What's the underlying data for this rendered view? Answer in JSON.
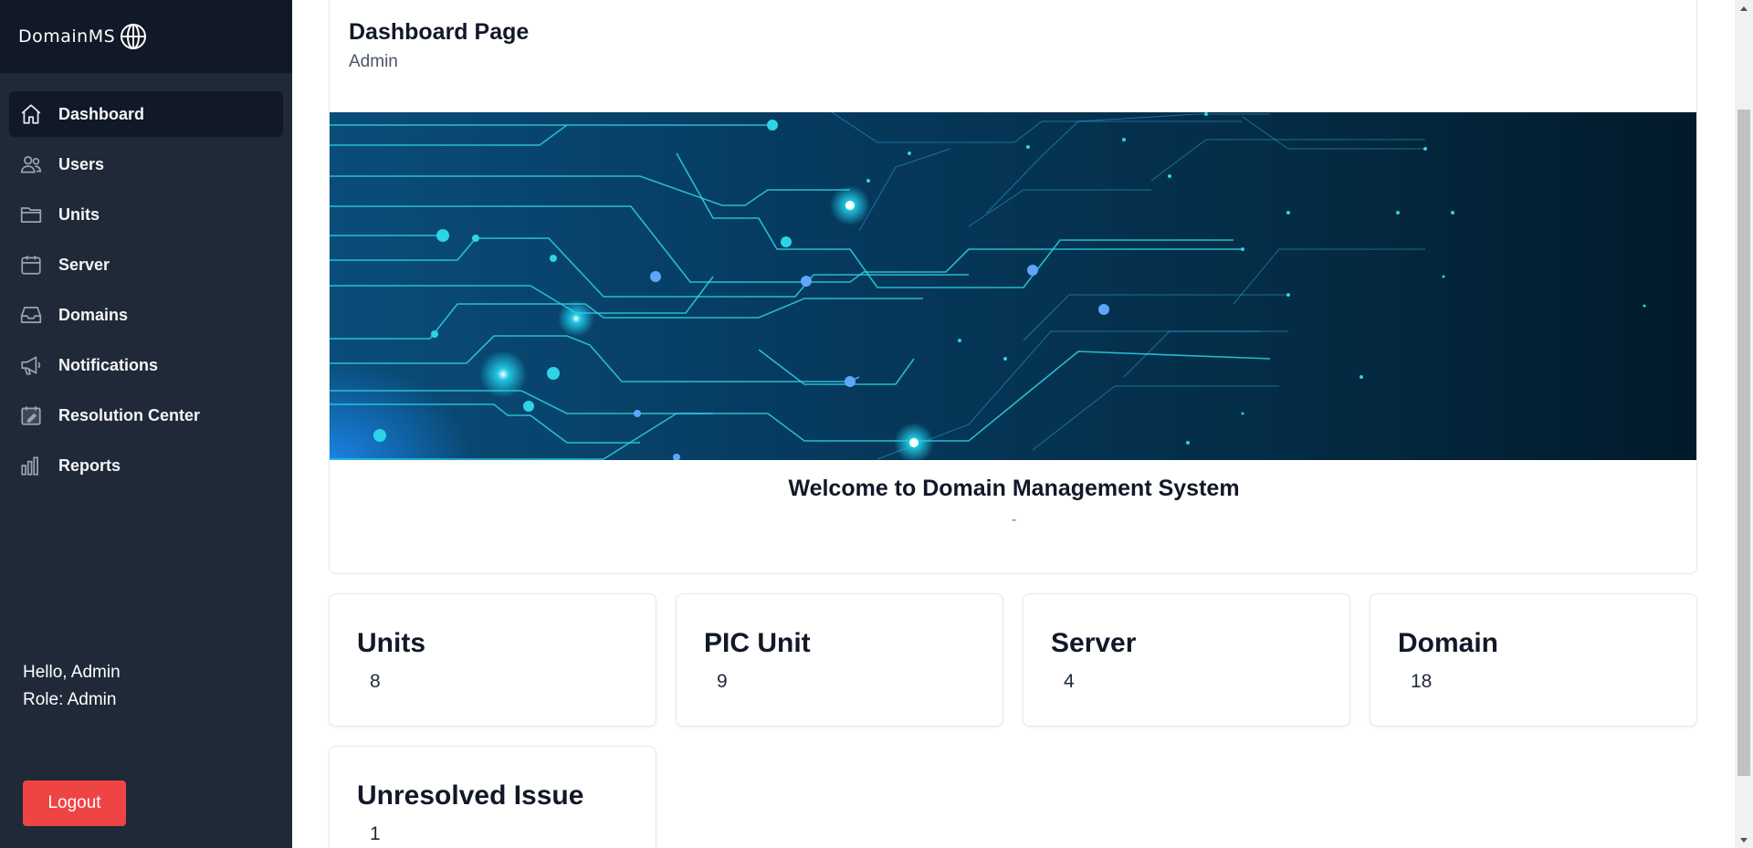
{
  "brand": {
    "name": "DomainMS"
  },
  "sidebar": {
    "items": [
      {
        "label": "Dashboard",
        "icon": "home-icon",
        "active": true
      },
      {
        "label": "Users",
        "icon": "users-icon"
      },
      {
        "label": "Units",
        "icon": "folder-icon"
      },
      {
        "label": "Server",
        "icon": "calendar-icon"
      },
      {
        "label": "Domains",
        "icon": "inbox-icon"
      },
      {
        "label": "Notifications",
        "icon": "megaphone-icon"
      },
      {
        "label": "Resolution Center",
        "icon": "calendar-edit-icon"
      },
      {
        "label": "Reports",
        "icon": "bar-chart-icon"
      }
    ],
    "greeting": "Hello, Admin",
    "role": "Role: Admin",
    "logout_label": "Logout"
  },
  "header": {
    "title": "Dashboard Page",
    "subtitle": "Admin"
  },
  "welcome": {
    "title": "Welcome to Domain Management System",
    "subtitle": "-"
  },
  "stats": [
    {
      "title": "Units",
      "value": "8"
    },
    {
      "title": "PIC Unit",
      "value": "9"
    },
    {
      "title": "Server",
      "value": "4"
    },
    {
      "title": "Domain",
      "value": "18"
    },
    {
      "title": "Unresolved Issue",
      "value": "1"
    }
  ],
  "colors": {
    "sidebar_bg": "#1f2937",
    "brand_bg": "#111827",
    "logout": "#ef4444",
    "banner_accent": "#22d3ee"
  }
}
